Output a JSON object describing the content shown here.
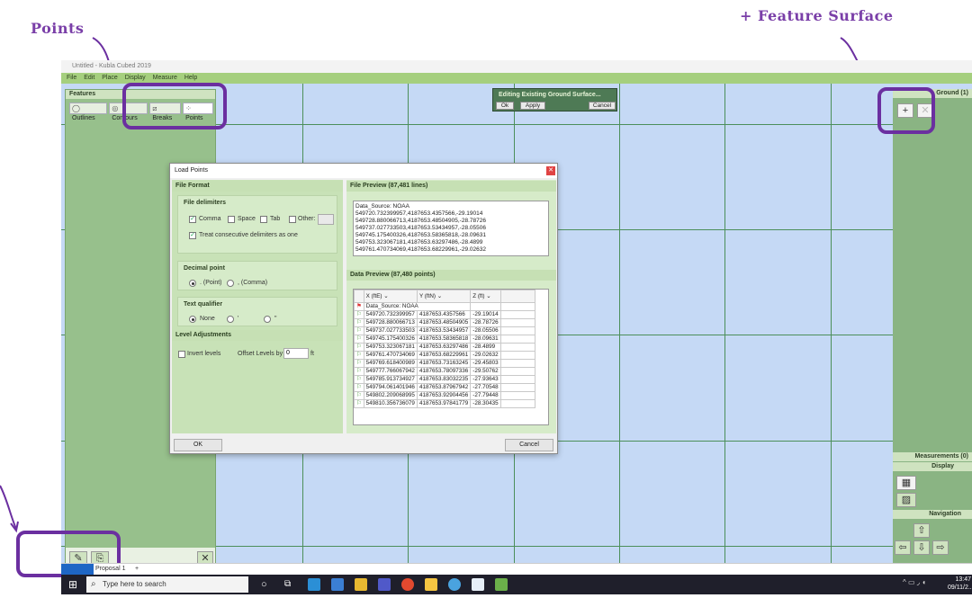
{
  "annotations": {
    "points": "Points",
    "feature_surface": "+ Feature Surface"
  },
  "app": {
    "title": "Untitled - Kubla Cubed 2019",
    "menu": [
      "File",
      "Edit",
      "Place",
      "Display",
      "Measure",
      "Help"
    ]
  },
  "features_panel": {
    "title": "Features",
    "tabs": [
      "Outlines",
      "Contours",
      "Breaks",
      "Points"
    ]
  },
  "right_panel": {
    "ground_title": "Ground (1)",
    "measurements_title": "Measurements (0)",
    "display_title": "Display",
    "navigation_title": "Navigation"
  },
  "edit_toolbar": {
    "label": "Editing Existing Ground Surface...",
    "ok": "Ok",
    "apply": "Apply",
    "cancel": "Cancel"
  },
  "dialog": {
    "title": "Load Points",
    "file_format_title": "File Format",
    "file_delimiters_title": "File delimiters",
    "comma": "Comma",
    "space": "Space",
    "tab": "Tab",
    "other": "Other:",
    "treat_consecutive": "Treat consecutive delimiters as one",
    "decimal_point_title": "Decimal point",
    "decimal_point_opt": ". (Point)",
    "decimal_comma_opt": ", (Comma)",
    "text_qualifier_title": "Text qualifier",
    "tq_none": "None",
    "tq_single": "'",
    "tq_double": "\"",
    "level_adjustments_title": "Level Adjustments",
    "invert_levels": "Invert levels",
    "offset_levels_by": "Offset Levels by",
    "offset_value": "0",
    "offset_unit": "ft",
    "file_preview_title": "File Preview (87,481 lines)",
    "file_preview_lines": [
      "Data_Source: NOAA",
      "549720.732399957,4187653.4357566,-29.19014",
      "549728.880066713,4187653.48504905,-28.78726",
      "549737.027733503,4187653.53434957,-28.05506",
      "549745.175400326,4187653.58365818,-28.09631",
      "549753.323067181,4187653.63297486,-28.4899",
      "549761.470734069,4187653.68229961,-29.02632"
    ],
    "data_preview_title": "Data Preview (87,480 points)",
    "columns": [
      "X (ftE)",
      "Y (ftN)",
      "Z (ft)"
    ],
    "data_source_row": "Data_Source: NOAA",
    "rows": [
      [
        "549720.732399957",
        "4187653.4357566",
        "-29.19014"
      ],
      [
        "549728.880066713",
        "4187653.48504905",
        "-28.78726"
      ],
      [
        "549737.027733503",
        "4187653.53434957",
        "-28.05506"
      ],
      [
        "549745.175400326",
        "4187653.58365818",
        "-28.09631"
      ],
      [
        "549753.323067181",
        "4187653.63297486",
        "-28.4899"
      ],
      [
        "549761.470734069",
        "4187653.68229961",
        "-29.02632"
      ],
      [
        "549769.618400989",
        "4187653.73163245",
        "-29.45803"
      ],
      [
        "549777.766067942",
        "4187653.78097336",
        "-29.50762"
      ],
      [
        "549785.913734927",
        "4187653.83032235",
        "-27.93643"
      ],
      [
        "549794.061401946",
        "4187653.87967942",
        "-27.70548"
      ],
      [
        "549802.209068995",
        "4187653.92904456",
        "-27.79448"
      ],
      [
        "549810.356736079",
        "4187653.97841779",
        "-28.30435"
      ]
    ],
    "ok": "OK",
    "cancel": "Cancel"
  },
  "bottom_tab": "Proposal 1",
  "taskbar": {
    "search_placeholder": "Type here to search",
    "time": "13:47",
    "date": "09/11/2..."
  }
}
